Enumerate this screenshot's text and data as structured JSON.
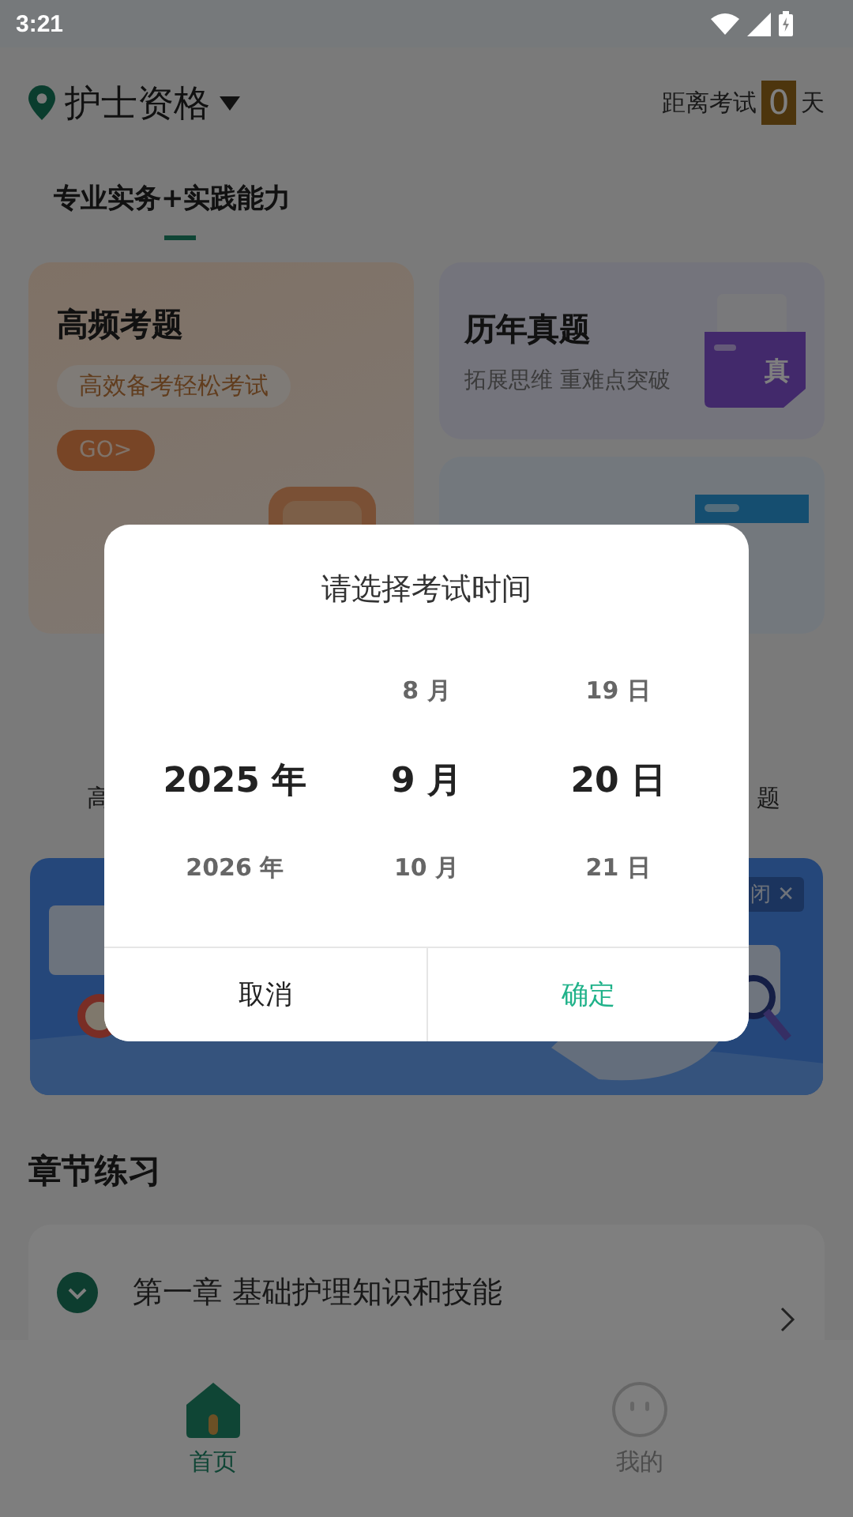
{
  "status_bar": {
    "time": "3:21"
  },
  "header": {
    "exam": "护士资格",
    "countdown_label": "距离考试",
    "countdown_value": "0",
    "countdown_unit": "天"
  },
  "tabs": [
    {
      "label": "专业实务+实践能力",
      "selected": true
    }
  ],
  "cards": [
    {
      "kind": "hot",
      "title": "高频考题",
      "tag": "高效备考轻松考试",
      "button": "GO>"
    },
    {
      "kind": "past",
      "title": "历年真题",
      "subtitle": "拓展思维 重难点突破",
      "icon_label": "真"
    },
    {
      "kind": "mock"
    }
  ],
  "shortcut_labels": [
    "高",
    "题"
  ],
  "banner": {
    "close": "闭 ✕"
  },
  "section_title": "章节练习",
  "chapters": [
    {
      "title": "第一章 基础护理知识和技能",
      "expanded": true
    }
  ],
  "dialog": {
    "title": "请选择考试时间",
    "columns": [
      {
        "items": [
          {
            "label": "2025 年",
            "selected": true
          },
          {
            "label": "2026 年",
            "selected": false
          }
        ]
      },
      {
        "items": [
          {
            "label": "8 月",
            "selected": false
          },
          {
            "label": "9 月",
            "selected": true
          },
          {
            "label": "10 月",
            "selected": false
          }
        ]
      },
      {
        "items": [
          {
            "label": "19 日",
            "selected": false
          },
          {
            "label": "20 日",
            "selected": true
          },
          {
            "label": "21 日",
            "selected": false
          }
        ]
      }
    ],
    "cancel": "取消",
    "confirm": "确定"
  },
  "nav": [
    {
      "kind": "home",
      "label": "首页",
      "selected": true
    },
    {
      "kind": "profile",
      "label": "我的",
      "selected": false
    }
  ]
}
